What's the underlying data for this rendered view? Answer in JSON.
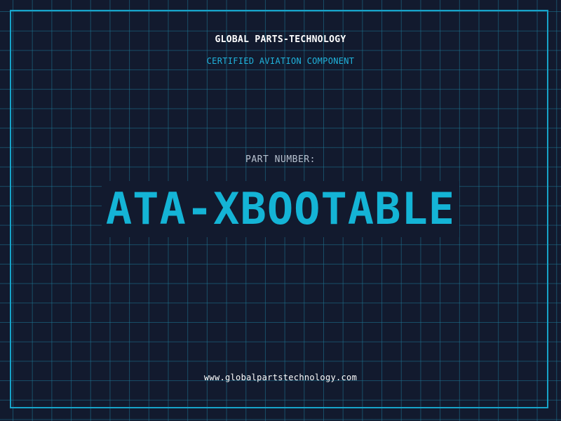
{
  "header": {
    "company": "GLOBAL PARTS-TECHNOLOGY",
    "tagline": "CERTIFIED AVIATION COMPONENT"
  },
  "part": {
    "label": "PART NUMBER:",
    "number": "ATA-XBOOTABLE"
  },
  "footer": {
    "website": "www.globalpartstechnology.com"
  },
  "colors": {
    "background": "#121a2e",
    "accent": "#14b4d6",
    "grid": "#1e7896",
    "text": "#ffffff"
  }
}
